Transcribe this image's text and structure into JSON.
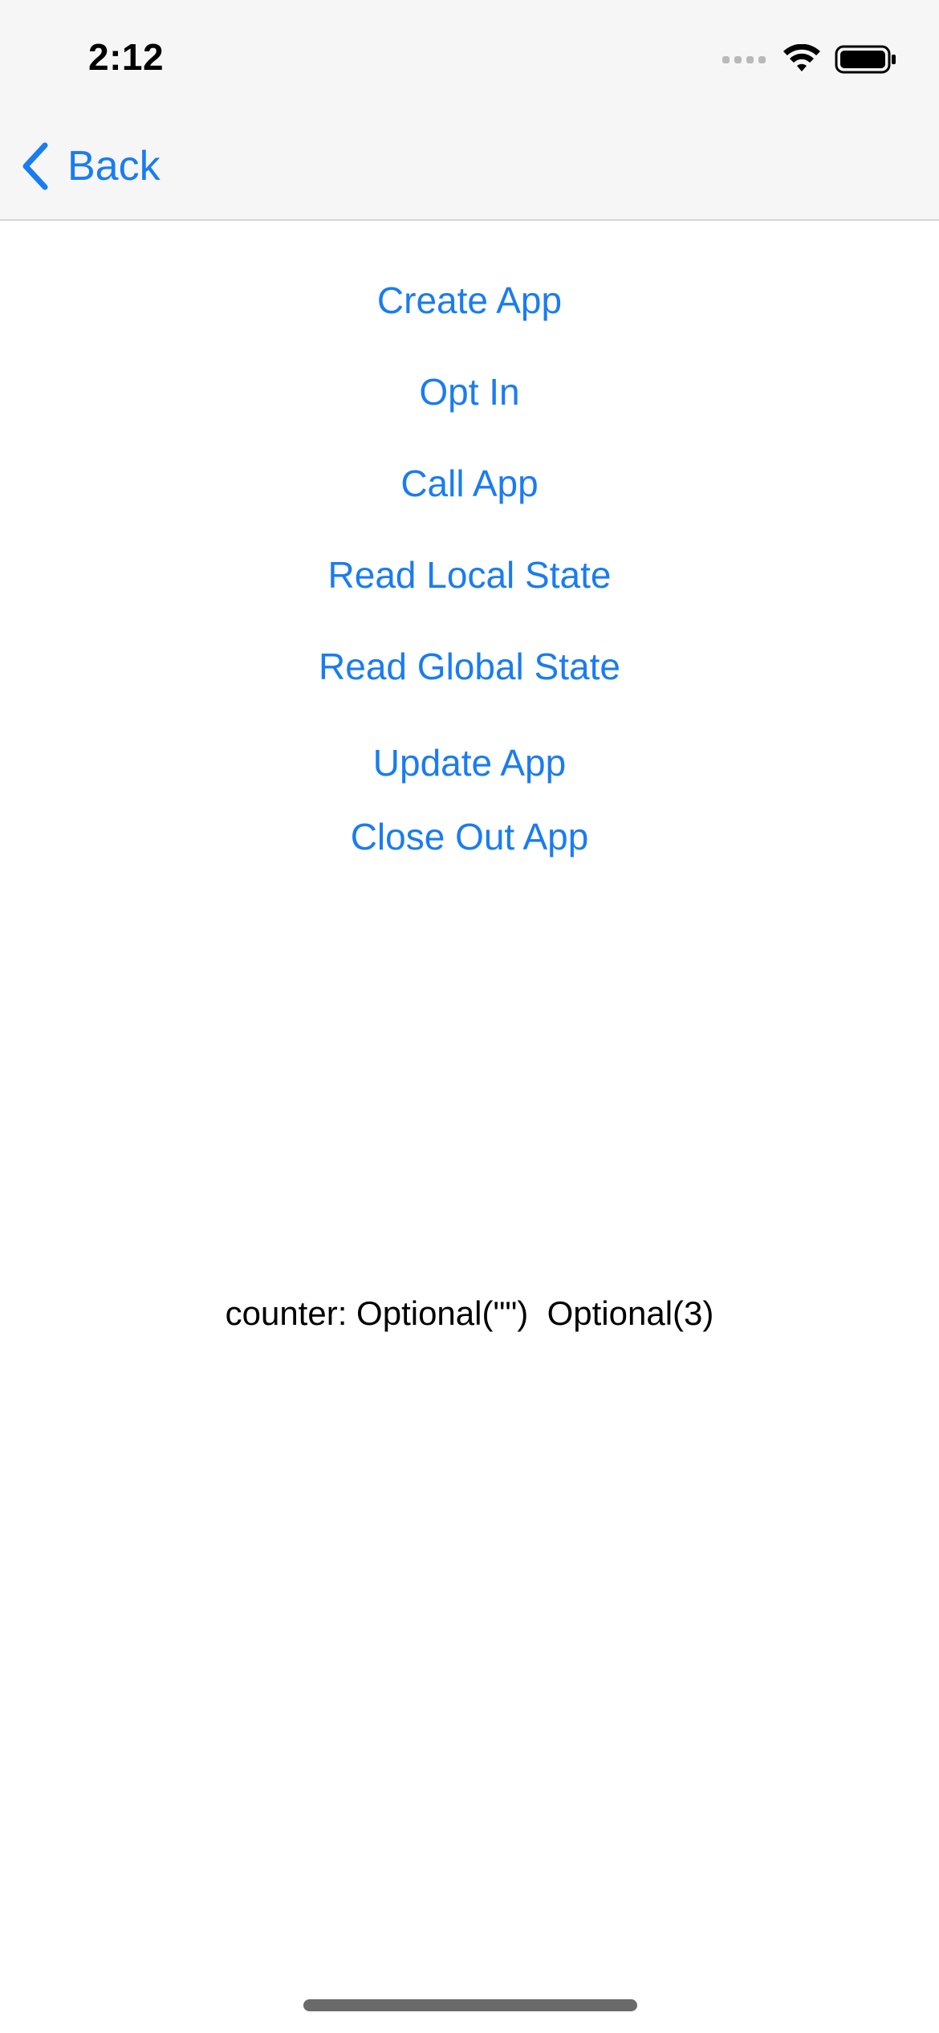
{
  "status_bar": {
    "time": "2:12",
    "icons": [
      "cellular-signal-icon",
      "wifi-icon",
      "battery-icon"
    ]
  },
  "nav": {
    "back_label": "Back",
    "back_icon": "chevron-left-icon"
  },
  "actions": {
    "create_app": "Create App",
    "opt_in": "Opt In",
    "call_app": "Call App",
    "read_local_state": "Read Local State",
    "read_global_state": "Read Global State",
    "update_app": "Update App",
    "close_out_app": "Close Out App"
  },
  "output": {
    "counter_text": "counter: Optional(\"\")  Optional(3)"
  },
  "colors": {
    "accent": "#1a7cf1",
    "nav_background": "#f6f6f6",
    "text": "#000000"
  }
}
